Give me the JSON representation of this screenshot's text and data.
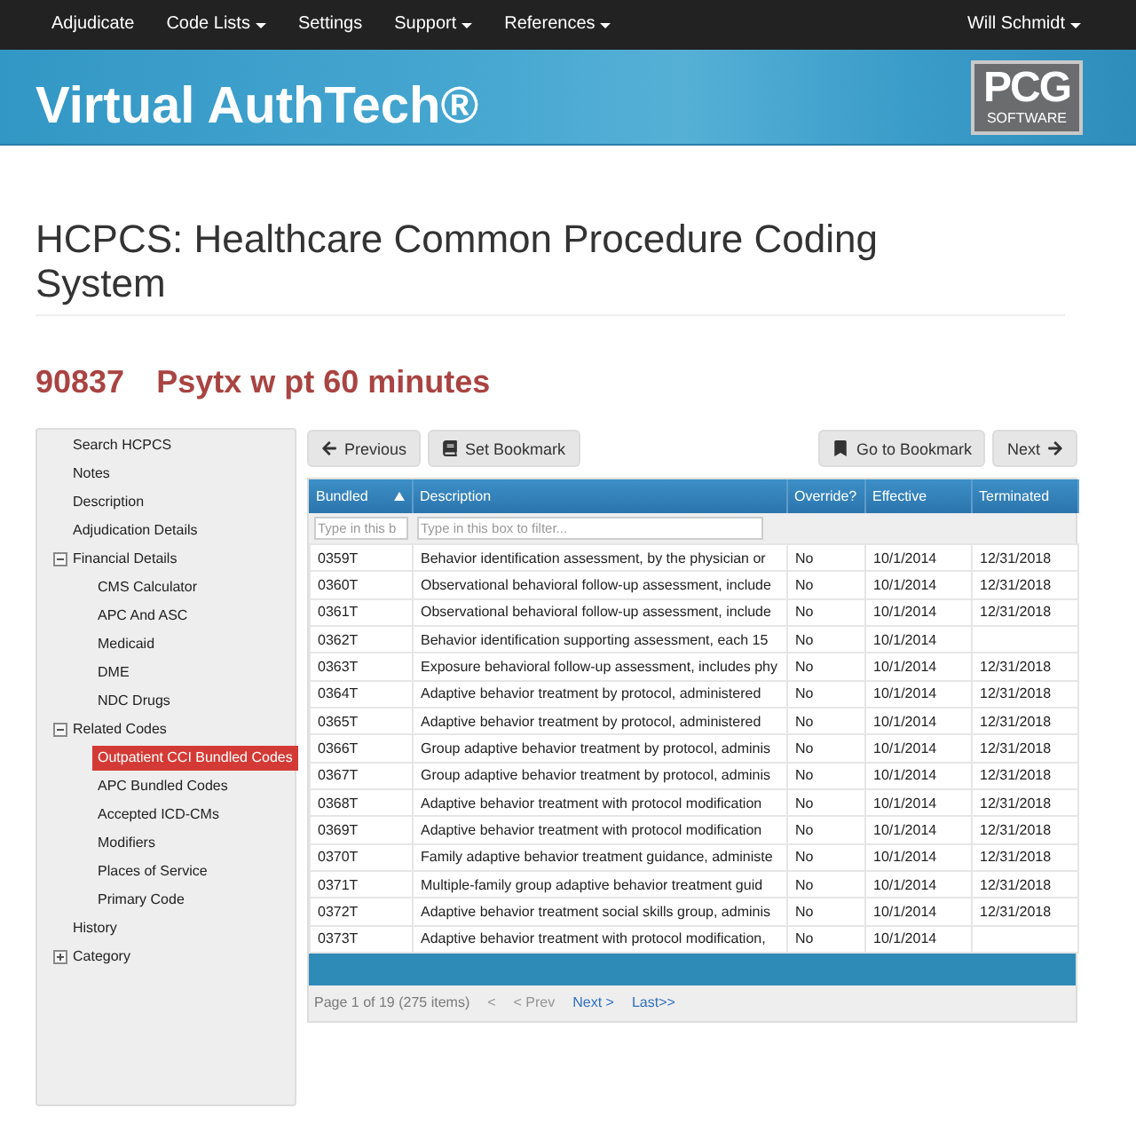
{
  "nav": {
    "items": [
      {
        "label": "Adjudicate",
        "dropdown": false
      },
      {
        "label": "Code Lists",
        "dropdown": true
      },
      {
        "label": "Settings",
        "dropdown": false
      },
      {
        "label": "Support",
        "dropdown": true
      },
      {
        "label": "References",
        "dropdown": true
      }
    ],
    "user_menu": {
      "label": "Will Schmidt",
      "dropdown": true
    }
  },
  "banner": {
    "title": "Virtual AuthTech®",
    "logo": {
      "text": "PCG",
      "subtext": "SOFTWARE"
    }
  },
  "page_title": "HCPCS: Healthcare Common Procedure Coding System",
  "code_heading": {
    "code": "90837",
    "description": "Psytx w pt 60 minutes"
  },
  "sidebar": {
    "items": [
      {
        "label": "Search HCPCS",
        "selected": false
      },
      {
        "label": "Notes",
        "selected": false
      },
      {
        "label": "Description",
        "selected": false
      },
      {
        "label": "Adjudication Details",
        "selected": false
      },
      {
        "label": "Financial Details",
        "selected": false,
        "expanded": true,
        "children": [
          {
            "label": "CMS Calculator",
            "selected": false
          },
          {
            "label": "APC And ASC",
            "selected": false
          },
          {
            "label": "Medicaid",
            "selected": false
          },
          {
            "label": "DME",
            "selected": false
          },
          {
            "label": "NDC Drugs",
            "selected": false
          }
        ]
      },
      {
        "label": "Related Codes",
        "selected": false,
        "expanded": true,
        "children": [
          {
            "label": "Outpatient CCI Bundled Codes",
            "selected": true
          },
          {
            "label": "APC Bundled Codes",
            "selected": false
          },
          {
            "label": "Accepted ICD-CMs",
            "selected": false
          },
          {
            "label": "Modifiers",
            "selected": false
          },
          {
            "label": "Places of Service",
            "selected": false
          },
          {
            "label": "Primary Code",
            "selected": false
          }
        ]
      },
      {
        "label": "History",
        "selected": false
      },
      {
        "label": "Category",
        "selected": false,
        "expanded": false
      }
    ]
  },
  "toolbar": {
    "previous": {
      "label": "Previous"
    },
    "set_bookmark": {
      "label": "Set Bookmark"
    },
    "go_to_bookmark": {
      "label": "Go to Bookmark"
    },
    "next": {
      "label": "Next"
    }
  },
  "table": {
    "columns": [
      {
        "label": "Bundled",
        "sorted": true
      },
      {
        "label": "Description",
        "sorted": false
      },
      {
        "label": "Override?",
        "sorted": false
      },
      {
        "label": "Effective",
        "sorted": false
      },
      {
        "label": "Terminated",
        "sorted": false
      }
    ],
    "filters": [
      {
        "placeholder": "Type in this b"
      },
      {
        "placeholder": "Type in this box to filter..."
      }
    ],
    "rows": [
      {
        "bundled": "0359T",
        "description": "Behavior identification assessment, by the physician or",
        "override": "No",
        "effective": "10/1/2014",
        "terminated": "12/31/2018"
      },
      {
        "bundled": "0360T",
        "description": "Observational behavioral follow-up assessment, include",
        "override": "No",
        "effective": "10/1/2014",
        "terminated": "12/31/2018"
      },
      {
        "bundled": "0361T",
        "description": "Observational behavioral follow-up assessment, include",
        "override": "No",
        "effective": "10/1/2014",
        "terminated": "12/31/2018"
      },
      {
        "bundled": "0362T",
        "description": "Behavior identification supporting assessment, each 15",
        "override": "No",
        "effective": "10/1/2014"
      },
      {
        "bundled": "0363T",
        "description": "Exposure behavioral follow-up assessment, includes phy",
        "override": "No",
        "effective": "10/1/2014",
        "terminated": "12/31/2018"
      },
      {
        "bundled": "0364T",
        "description": "Adaptive behavior treatment by protocol, administered",
        "override": "No",
        "effective": "10/1/2014",
        "terminated": "12/31/2018"
      },
      {
        "bundled": "0365T",
        "description": "Adaptive behavior treatment by protocol, administered",
        "override": "No",
        "effective": "10/1/2014",
        "terminated": "12/31/2018"
      },
      {
        "bundled": "0366T",
        "description": "Group adaptive behavior treatment by protocol, adminis",
        "override": "No",
        "effective": "10/1/2014",
        "terminated": "12/31/2018"
      },
      {
        "bundled": "0367T",
        "description": "Group adaptive behavior treatment by protocol, adminis",
        "override": "No",
        "effective": "10/1/2014",
        "terminated": "12/31/2018"
      },
      {
        "bundled": "0368T",
        "description": "Adaptive behavior treatment with protocol modification",
        "override": "No",
        "effective": "10/1/2014",
        "terminated": "12/31/2018"
      },
      {
        "bundled": "0369T",
        "description": "Adaptive behavior treatment with protocol modification",
        "override": "No",
        "effective": "10/1/2014",
        "terminated": "12/31/2018"
      },
      {
        "bundled": "0370T",
        "description": "Family adaptive behavior treatment guidance, administe",
        "override": "No",
        "effective": "10/1/2014",
        "terminated": "12/31/2018"
      },
      {
        "bundled": "0371T",
        "description": "Multiple-family group adaptive behavior treatment guid",
        "override": "No",
        "effective": "10/1/2014",
        "terminated": "12/31/2018"
      },
      {
        "bundled": "0372T",
        "description": "Adaptive behavior treatment social skills group, adminis",
        "override": "No",
        "effective": "10/1/2014",
        "terminated": "12/31/2018"
      },
      {
        "bundled": "0373T",
        "description": "Adaptive behavior treatment with protocol modification,",
        "override": "No",
        "effective": "10/1/2014"
      }
    ]
  },
  "pager": {
    "info": "Page 1 of 19 (275 items)",
    "links": [
      {
        "label": "<",
        "disabled": true
      },
      {
        "label": "< Prev",
        "disabled": true
      },
      {
        "label": "Next >",
        "disabled": false
      },
      {
        "label": "Last>>",
        "disabled": false
      }
    ]
  }
}
